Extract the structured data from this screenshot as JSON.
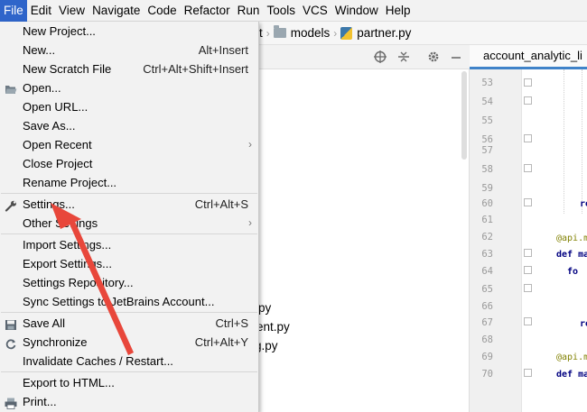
{
  "menubar": {
    "items": [
      "File",
      "Edit",
      "View",
      "Navigate",
      "Code",
      "Refactor",
      "Run",
      "Tools",
      "VCS",
      "Window",
      "Help"
    ],
    "active": "File"
  },
  "breadcrumb": {
    "partial": "t",
    "folder": "models",
    "file": "partner.py"
  },
  "editor_tab": {
    "label": "account_analytic_li"
  },
  "project_files": [
    {
      "text": "py"
    },
    {
      "text": "ent.py"
    },
    {
      "text": "g.py"
    }
  ],
  "line_numbers": [
    "53",
    "54",
    "55",
    "56",
    "57",
    "58",
    "59",
    "60",
    "61",
    "62",
    "63",
    "64",
    "65",
    "66",
    "67",
    "68",
    "69",
    "70"
  ],
  "code_fragments": {
    "l60": "re",
    "l62": "@api.m",
    "l63": "def ma",
    "l64": "fo",
    "l67": "re",
    "l69": "@api.m",
    "l70": "def ma"
  },
  "file_menu": {
    "items": [
      {
        "label": "New Project...",
        "shortcut": "",
        "submenu": false,
        "icon": ""
      },
      {
        "label": "New...",
        "shortcut": "Alt+Insert",
        "submenu": false,
        "icon": ""
      },
      {
        "label": "New Scratch File",
        "shortcut": "Ctrl+Alt+Shift+Insert",
        "submenu": false,
        "icon": ""
      },
      {
        "label": "Open...",
        "shortcut": "",
        "submenu": false,
        "icon": "folder-open-icon"
      },
      {
        "label": "Open URL...",
        "shortcut": "",
        "submenu": false,
        "icon": ""
      },
      {
        "label": "Save As...",
        "shortcut": "",
        "submenu": false,
        "icon": ""
      },
      {
        "label": "Open Recent",
        "shortcut": "",
        "submenu": true,
        "icon": ""
      },
      {
        "label": "Close Project",
        "shortcut": "",
        "submenu": false,
        "icon": ""
      },
      {
        "label": "Rename Project...",
        "shortcut": "",
        "submenu": false,
        "icon": ""
      },
      {
        "label": "Settings...",
        "shortcut": "Ctrl+Alt+S",
        "submenu": false,
        "icon": "wrench-icon"
      },
      {
        "label": "Other Settings",
        "shortcut": "",
        "submenu": true,
        "icon": ""
      },
      {
        "label": "Import Settings...",
        "shortcut": "",
        "submenu": false,
        "icon": ""
      },
      {
        "label": "Export Settings...",
        "shortcut": "",
        "submenu": false,
        "icon": ""
      },
      {
        "label": "Settings Repository...",
        "shortcut": "",
        "submenu": false,
        "icon": ""
      },
      {
        "label": "Sync Settings to JetBrains Account...",
        "shortcut": "",
        "submenu": false,
        "icon": ""
      },
      {
        "label": "Save All",
        "shortcut": "Ctrl+S",
        "submenu": false,
        "icon": "save-icon"
      },
      {
        "label": "Synchronize",
        "shortcut": "Ctrl+Alt+Y",
        "submenu": false,
        "icon": "sync-icon"
      },
      {
        "label": "Invalidate Caches / Restart...",
        "shortcut": "",
        "submenu": false,
        "icon": ""
      },
      {
        "label": "Export to HTML...",
        "shortcut": "",
        "submenu": false,
        "icon": ""
      },
      {
        "label": "Print...",
        "shortcut": "",
        "submenu": false,
        "icon": "print-icon"
      }
    ]
  },
  "colors": {
    "menu_active": "#2f65ca",
    "annotation_arrow": "#e8473b",
    "tab_underline": "#4083c9"
  }
}
